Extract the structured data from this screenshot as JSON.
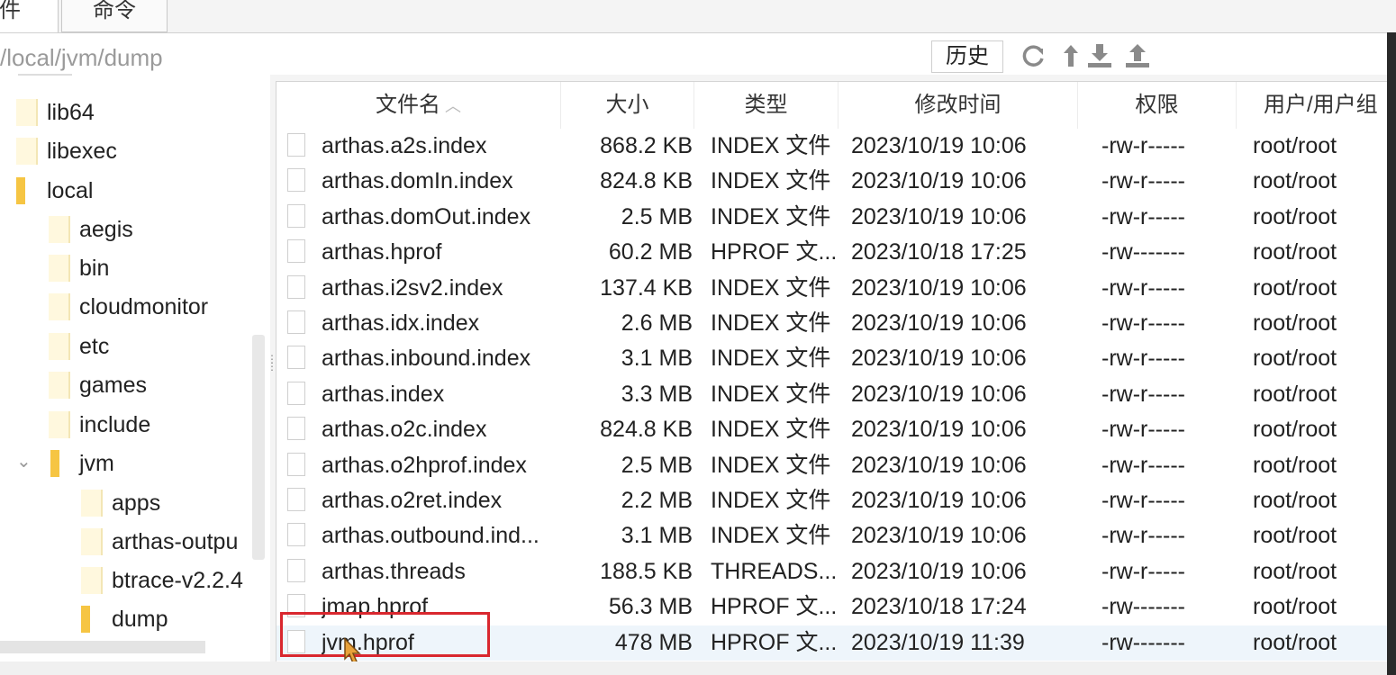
{
  "tabs": [
    "件",
    "命令"
  ],
  "path": "/local/jvm/dump",
  "history_label": "历史",
  "toolbar_icons": [
    "refresh-icon",
    "up-arrow-icon",
    "download-icon",
    "upload-icon"
  ],
  "sidebar": {
    "items": [
      {
        "label": "lib64",
        "indent": 0
      },
      {
        "label": "libexec",
        "indent": 0
      },
      {
        "label": "local",
        "indent": 0
      },
      {
        "label": "aegis",
        "indent": 1
      },
      {
        "label": "bin",
        "indent": 1
      },
      {
        "label": "cloudmonitor",
        "indent": 1
      },
      {
        "label": "etc",
        "indent": 1
      },
      {
        "label": "games",
        "indent": 1
      },
      {
        "label": "include",
        "indent": 1
      },
      {
        "label": "jvm",
        "indent": 1
      },
      {
        "label": "apps",
        "indent": 2
      },
      {
        "label": "arthas-outpu",
        "indent": 2
      },
      {
        "label": "btrace-v2.2.4",
        "indent": 2
      },
      {
        "label": "dump",
        "indent": 2
      }
    ]
  },
  "columns": [
    "文件名",
    "大小",
    "类型",
    "修改时间",
    "权限",
    "用户/用户组"
  ],
  "files": [
    {
      "name": "arthas.a2s.index",
      "size": "868.2 KB",
      "type": "INDEX 文件",
      "modified": "2023/10/19 10:06",
      "perm": "-rw-r-----",
      "owner": "root/root"
    },
    {
      "name": "arthas.domIn.index",
      "size": "824.8 KB",
      "type": "INDEX 文件",
      "modified": "2023/10/19 10:06",
      "perm": "-rw-r-----",
      "owner": "root/root"
    },
    {
      "name": "arthas.domOut.index",
      "size": "2.5 MB",
      "type": "INDEX 文件",
      "modified": "2023/10/19 10:06",
      "perm": "-rw-r-----",
      "owner": "root/root"
    },
    {
      "name": "arthas.hprof",
      "size": "60.2 MB",
      "type": "HPROF 文...",
      "modified": "2023/10/18 17:25",
      "perm": "-rw-------",
      "owner": "root/root"
    },
    {
      "name": "arthas.i2sv2.index",
      "size": "137.4 KB",
      "type": "INDEX 文件",
      "modified": "2023/10/19 10:06",
      "perm": "-rw-r-----",
      "owner": "root/root"
    },
    {
      "name": "arthas.idx.index",
      "size": "2.6 MB",
      "type": "INDEX 文件",
      "modified": "2023/10/19 10:06",
      "perm": "-rw-r-----",
      "owner": "root/root"
    },
    {
      "name": "arthas.inbound.index",
      "size": "3.1 MB",
      "type": "INDEX 文件",
      "modified": "2023/10/19 10:06",
      "perm": "-rw-r-----",
      "owner": "root/root"
    },
    {
      "name": "arthas.index",
      "size": "3.3 MB",
      "type": "INDEX 文件",
      "modified": "2023/10/19 10:06",
      "perm": "-rw-r-----",
      "owner": "root/root"
    },
    {
      "name": "arthas.o2c.index",
      "size": "824.8 KB",
      "type": "INDEX 文件",
      "modified": "2023/10/19 10:06",
      "perm": "-rw-r-----",
      "owner": "root/root"
    },
    {
      "name": "arthas.o2hprof.index",
      "size": "2.5 MB",
      "type": "INDEX 文件",
      "modified": "2023/10/19 10:06",
      "perm": "-rw-r-----",
      "owner": "root/root"
    },
    {
      "name": "arthas.o2ret.index",
      "size": "2.2 MB",
      "type": "INDEX 文件",
      "modified": "2023/10/19 10:06",
      "perm": "-rw-r-----",
      "owner": "root/root"
    },
    {
      "name": "arthas.outbound.ind...",
      "size": "3.1 MB",
      "type": "INDEX 文件",
      "modified": "2023/10/19 10:06",
      "perm": "-rw-r-----",
      "owner": "root/root"
    },
    {
      "name": "arthas.threads",
      "size": "188.5 KB",
      "type": "THREADS...",
      "modified": "2023/10/19 10:06",
      "perm": "-rw-r-----",
      "owner": "root/root"
    },
    {
      "name": "jmap.hprof",
      "size": "56.3 MB",
      "type": "HPROF 文...",
      "modified": "2023/10/18 17:24",
      "perm": "-rw-------",
      "owner": "root/root"
    },
    {
      "name": "jvm.hprof",
      "size": "478 MB",
      "type": "HPROF 文...",
      "modified": "2023/10/19 11:39",
      "perm": "-rw-------",
      "owner": "root/root",
      "selected": true
    }
  ],
  "highlight_color": "#d9272e",
  "folder_color": "#f6c543"
}
